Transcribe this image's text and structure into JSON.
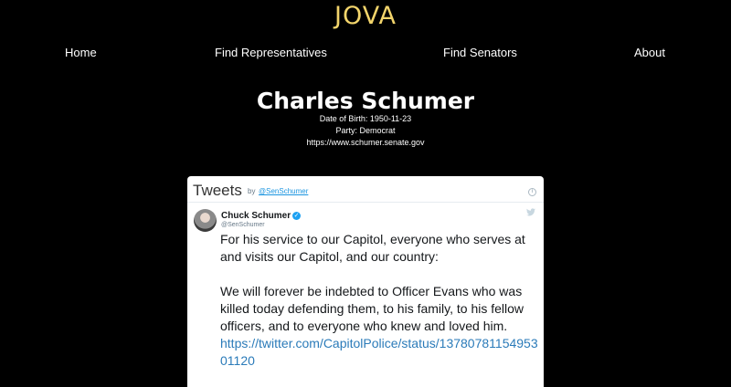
{
  "site": {
    "brand": "JOVA"
  },
  "nav": [
    "Home",
    "Find Representatives",
    "Find Senators",
    "About"
  ],
  "senator": {
    "name": "Charles Schumer",
    "dob": "Date of Birth: 1950-11-23",
    "party": "Party: Democrat",
    "website": "https://www.schumer.senate.gov"
  },
  "timeline": {
    "title": "Tweets",
    "by": "by",
    "handle_link": "@SenSchumer"
  },
  "tweet": {
    "author": "Chuck Schumer",
    "handle": "@SenSchumer",
    "paragraph1": "For his service to our Capitol, everyone who serves at and visits our Capitol, and our country:",
    "paragraph2": "We will forever be indebted to Officer Evans who was killed today defending them, to his family, to his fellow officers, and to everyone who knew and loved him.",
    "link": "https://twitter.com/CapitolPolice/status/1378078115495301120"
  },
  "colors": {
    "background": "#000000",
    "brand": "#f2d46b",
    "link": "#2b7bb9",
    "verified": "#1da1f2"
  },
  "icons": [
    "info-icon",
    "verified-icon",
    "twitter-bird-icon",
    "avatar"
  ]
}
